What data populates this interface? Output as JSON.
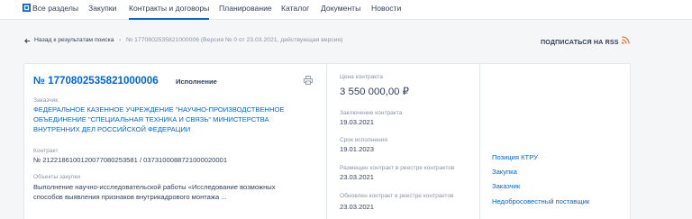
{
  "nav": {
    "items": [
      {
        "label": "Все разделы"
      },
      {
        "label": "Закупки"
      },
      {
        "label": "Контракты и договоры"
      },
      {
        "label": "Планирование"
      },
      {
        "label": "Каталог"
      },
      {
        "label": "Документы"
      },
      {
        "label": "Новости"
      }
    ],
    "active_index": 2
  },
  "breadcrumb": {
    "back_label": "Назад к результатам поиска",
    "separator": "›",
    "current": "№ 1770802535821000006 (Версия № 0 от 23.03.2021, действующая версия)"
  },
  "subscribe_label": "ПОДПИСАТЬСЯ НА RSS",
  "contract": {
    "number": "№ 1770802535821000006",
    "status": "Исполнение",
    "customer_label": "Заказчик",
    "customer_name": "ФЕДЕРАЛЬНОЕ КАЗЕННОЕ УЧРЕЖДЕНИЕ \"НАУЧНО-ПРОИЗВОДСТВЕННОЕ ОБЪЕДИНЕНИЕ \"СПЕЦИАЛЬНАЯ ТЕХНИКА И СВЯЗЬ\" МИНИСТЕРСТВА ВНУТРЕННИХ ДЕЛ РОССИЙСКОЙ ФЕДЕРАЦИИ",
    "contract_label": "Контракт",
    "contract_numbers": "№ 2122186100120077080253581 / 0373100088721000020001",
    "subject_label": "Объекты закупки",
    "subject_text": "Выполнение научно-исследовательской работы «Исследование возможных способов выявления признаков внутрикадрового монтажа ..."
  },
  "middle": {
    "price_label": "Цена контракта",
    "price_value": "3 550 000,00 ₽",
    "conclusion_label": "Заключение контракта",
    "conclusion_date": "19.03.2021",
    "execution_label": "Срок исполнения",
    "execution_date": "19.01.2023",
    "placed_label": "Размещен контракт в реестре контрактов",
    "placed_date": "23.03.2021",
    "updated_label": "Обновлен контракт в реестре контрактов",
    "updated_date": "23.03.2021"
  },
  "right_links": [
    {
      "label": "Позиция КТРУ"
    },
    {
      "label": "Закупка"
    },
    {
      "label": "Заказчик"
    },
    {
      "label": "Недобросовестный поставщик"
    }
  ],
  "colors": {
    "accent": "#0065dd",
    "rss": "#f26522",
    "text": "#334059",
    "muted": "#8a94a6"
  }
}
